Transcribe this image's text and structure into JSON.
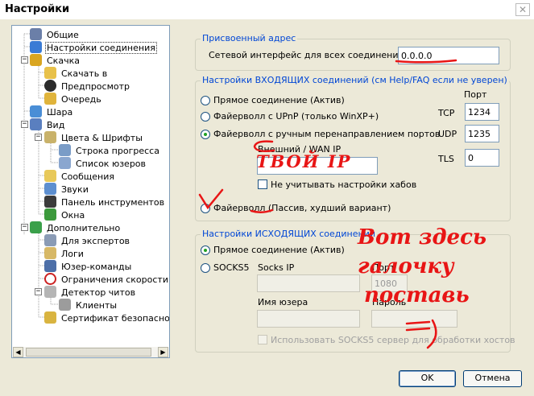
{
  "window": {
    "title": "Настройки",
    "close_icon": "close-icon"
  },
  "sidebar": {
    "items": [
      {
        "label": "Общие",
        "icon": "gear-icon"
      },
      {
        "label": "Настройки соединения",
        "icon": "globe-network-icon",
        "selected": true
      },
      {
        "label": "Скачка",
        "icon": "download-icon"
      },
      {
        "label": "Скачать в",
        "icon": "folder-icon"
      },
      {
        "label": "Предпросмотр",
        "icon": "play-icon"
      },
      {
        "label": "Очередь",
        "icon": "queue-icon"
      },
      {
        "label": "Шара",
        "icon": "share-icon"
      },
      {
        "label": "Вид",
        "icon": "view-icon"
      },
      {
        "label": "Цвета & Шрифты",
        "icon": "palette-icon"
      },
      {
        "label": "Строка прогресса",
        "icon": "progress-icon"
      },
      {
        "label": "Список юзеров",
        "icon": "users-icon"
      },
      {
        "label": "Сообщения",
        "icon": "message-icon"
      },
      {
        "label": "Звуки",
        "icon": "sound-icon"
      },
      {
        "label": "Панель инструментов",
        "icon": "toolbar-icon"
      },
      {
        "label": "Окна",
        "icon": "windows-icon"
      },
      {
        "label": "Дополнительно",
        "icon": "check-icon"
      },
      {
        "label": "Для экспертов",
        "icon": "gear-icon"
      },
      {
        "label": "Логи",
        "icon": "log-icon"
      },
      {
        "label": "Юзер-команды",
        "icon": "command-icon"
      },
      {
        "label": "Ограничения скорости",
        "icon": "speed-limit-icon"
      },
      {
        "label": "Детектор читов",
        "icon": "detector-icon"
      },
      {
        "label": "Клиенты",
        "icon": "client-icon"
      },
      {
        "label": "Сертификат безопасности",
        "icon": "lock-icon"
      }
    ]
  },
  "assigned": {
    "legend": "Присвоенный адрес",
    "label": "Сетевой интерфейс для всех соединений",
    "value": "0.0.0.0"
  },
  "incoming": {
    "legend": "Настройки ВХОДЯЩИХ соединений (см Help/FAQ если не уверен)",
    "port_label": "Порт",
    "options": [
      {
        "label": "Прямое соединение (Актив)",
        "checked": false
      },
      {
        "label": "Файерволл с UPnP (только WinXP+)",
        "checked": false
      },
      {
        "label": "Файерволл с ручным перенаправлением портов",
        "checked": true
      },
      {
        "label": "Файерволл (Пассив, худший вариант)",
        "checked": false
      }
    ],
    "tcp_label": "TCP",
    "tcp_value": "1234",
    "udp_label": "UDP",
    "udp_value": "1235",
    "tls_label": "TLS",
    "tls_value": "0",
    "wan_label": "Внешний / WAN IP",
    "wan_value": "",
    "hubs_checkbox": "Не учитывать настройки хабов"
  },
  "outgoing": {
    "legend": "Настройки ИСХОДЯЩИХ соединений",
    "direct_label": "Прямое соединение (Актив)",
    "socks_label": "SOCKS5",
    "socks_ip_label": "Socks IP",
    "port_label": "Порт",
    "port_value": "1080",
    "user_label": "Имя юзера",
    "pass_label": "Пароль",
    "use_socks_label": "Использовать SOCKS5 сервер для обработки хостов"
  },
  "buttons": {
    "ok": "OK",
    "cancel": "Отмена"
  },
  "annotations": {
    "your_ip": "ТВОЙ IP",
    "line1": "Вот здесь",
    "line2": "галочку",
    "line3": "поставь",
    "smiley": "=)",
    "ink_color": "#e81515"
  }
}
